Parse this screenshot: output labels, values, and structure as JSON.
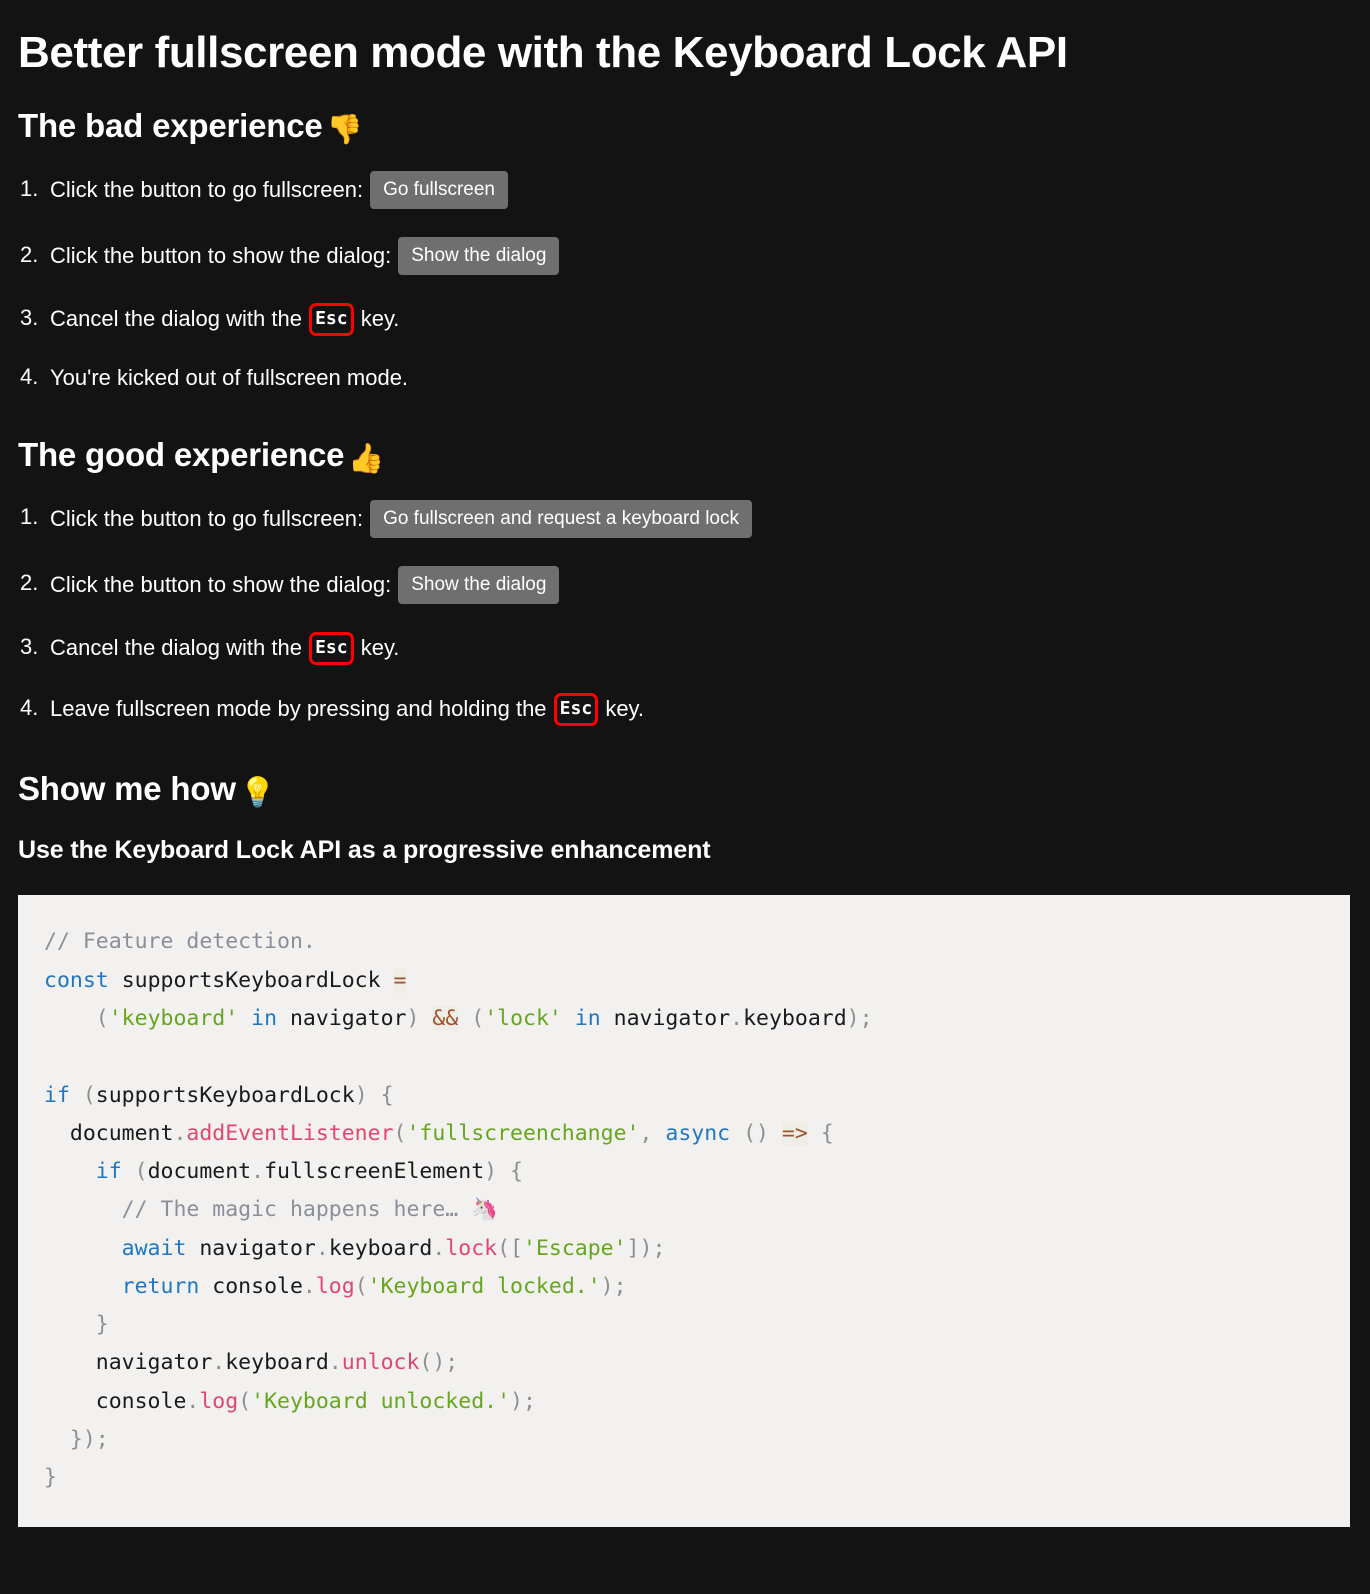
{
  "page": {
    "background_color": "#131313",
    "text_color": "#ffffff",
    "title": "Better fullscreen mode with the Keyboard Lock API"
  },
  "bad_section": {
    "heading": "The bad experience",
    "emoji": "👎",
    "emoji_name": "thumbs-down",
    "steps": [
      {
        "text": "Click the button to go fullscreen:",
        "button": "Go fullscreen"
      },
      {
        "text": "Click the button to show the dialog:",
        "button": "Show the dialog"
      },
      {
        "prefix": "Cancel the dialog with the",
        "kbd": "Esc",
        "suffix": "key."
      },
      {
        "text": "You're kicked out of fullscreen mode."
      }
    ]
  },
  "good_section": {
    "heading": "The good experience",
    "emoji": "👍",
    "emoji_name": "thumbs-up",
    "steps": [
      {
        "text": "Click the button to go fullscreen:",
        "button": "Go fullscreen and request a keyboard lock"
      },
      {
        "text": "Click the button to show the dialog:",
        "button": "Show the dialog"
      },
      {
        "prefix": "Cancel the dialog with the",
        "kbd": "Esc",
        "suffix": "key."
      },
      {
        "prefix": "Leave fullscreen mode by pressing and holding the",
        "kbd": "Esc",
        "suffix": "key."
      }
    ]
  },
  "howto_section": {
    "heading": "Show me how",
    "emoji": "💡",
    "emoji_name": "light-bulb",
    "subheading": "Use the Keyboard Lock API as a progressive enhancement"
  },
  "code": {
    "language": "javascript",
    "background_color": "#f2f1ef",
    "colors": {
      "comment": "#8a8f99",
      "keyword": "#1f77c4",
      "string": "#66a61e",
      "function": "#e0476e",
      "punctuation": "#8f8f8f",
      "operator": "#a0522d"
    },
    "plain_text": "// Feature detection.\nconst supportsKeyboardLock =\n    ('keyboard' in navigator) && ('lock' in navigator.keyboard);\n\nif (supportsKeyboardLock) {\n  document.addEventListener('fullscreenchange', async () => {\n    if (document.fullscreenElement) {\n      // The magic happens here… 🦄\n      await navigator.keyboard.lock(['Escape']);\n      return console.log('Keyboard locked.');\n    }\n    navigator.keyboard.unlock();\n    console.log('Keyboard unlocked.');\n  });\n}"
  },
  "kbd_style": {
    "border_color": "#ff0000",
    "label": "Esc"
  },
  "button_style": {
    "background_color": "#6f6f6f",
    "text_color": "#ffffff"
  }
}
